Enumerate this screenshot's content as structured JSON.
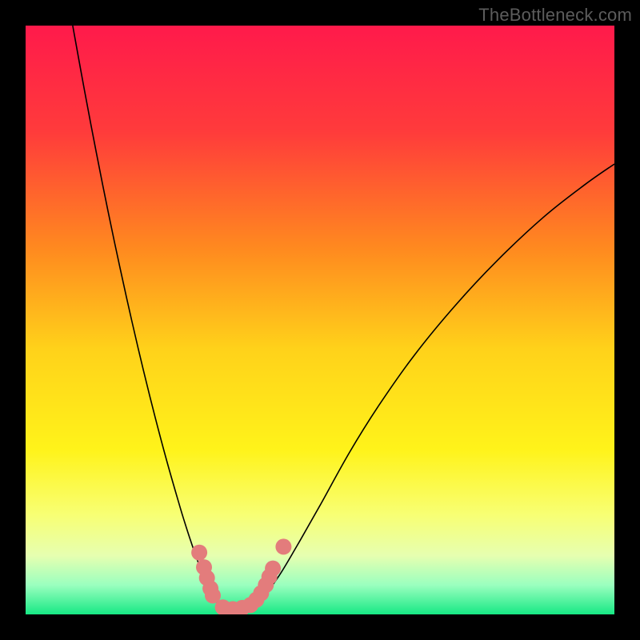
{
  "watermark": "TheBottleneck.com",
  "chart_data": {
    "type": "line",
    "title": "",
    "xlabel": "",
    "ylabel": "",
    "xlim": [
      0,
      100
    ],
    "ylim": [
      0,
      100
    ],
    "grid": false,
    "legend": false,
    "gradient_stops": [
      {
        "offset": 0.0,
        "color": "#ff1a4b"
      },
      {
        "offset": 0.18,
        "color": "#ff3b3b"
      },
      {
        "offset": 0.38,
        "color": "#ff8a1f"
      },
      {
        "offset": 0.55,
        "color": "#ffd21a"
      },
      {
        "offset": 0.72,
        "color": "#fff31a"
      },
      {
        "offset": 0.83,
        "color": "#f8ff73"
      },
      {
        "offset": 0.9,
        "color": "#e6ffb0"
      },
      {
        "offset": 0.95,
        "color": "#9bffbf"
      },
      {
        "offset": 1.0,
        "color": "#17e884"
      }
    ],
    "series": [
      {
        "name": "left-arm",
        "stroke": "#000000",
        "stroke_width": 1.6,
        "x": [
          8.0,
          10.0,
          12.0,
          14.0,
          16.0,
          18.0,
          20.0,
          22.0,
          24.0,
          26.0,
          27.0,
          28.0,
          29.0,
          30.0,
          31.0,
          32.0,
          33.0,
          34.0
        ],
        "y": [
          100.0,
          89.0,
          78.5,
          68.5,
          59.0,
          50.0,
          41.5,
          33.5,
          26.0,
          19.0,
          15.7,
          12.6,
          9.7,
          7.0,
          4.7,
          2.8,
          1.4,
          0.2
        ]
      },
      {
        "name": "right-arm",
        "stroke": "#000000",
        "stroke_width": 1.6,
        "x": [
          38.0,
          40.0,
          43.0,
          46.0,
          50.0,
          55.0,
          60.0,
          66.0,
          73.0,
          80.0,
          88.0,
          95.0,
          100.0
        ],
        "y": [
          0.5,
          2.5,
          6.5,
          11.5,
          18.5,
          27.5,
          35.5,
          44.0,
          52.5,
          60.0,
          67.5,
          73.0,
          76.5
        ]
      }
    ],
    "scatter": [
      {
        "name": "valley-dots",
        "color": "#e37c7c",
        "radius": 10,
        "points": [
          {
            "x": 29.5,
            "y": 10.5
          },
          {
            "x": 30.3,
            "y": 8.0
          },
          {
            "x": 30.8,
            "y": 6.2
          },
          {
            "x": 31.4,
            "y": 4.4
          },
          {
            "x": 31.8,
            "y": 3.2
          },
          {
            "x": 33.5,
            "y": 1.2
          },
          {
            "x": 35.2,
            "y": 0.9
          },
          {
            "x": 36.8,
            "y": 1.1
          },
          {
            "x": 38.2,
            "y": 1.6
          },
          {
            "x": 39.2,
            "y": 2.5
          },
          {
            "x": 40.0,
            "y": 3.6
          },
          {
            "x": 40.8,
            "y": 5.0
          },
          {
            "x": 41.4,
            "y": 6.4
          },
          {
            "x": 42.0,
            "y": 7.8
          },
          {
            "x": 43.8,
            "y": 11.5
          }
        ]
      }
    ]
  }
}
